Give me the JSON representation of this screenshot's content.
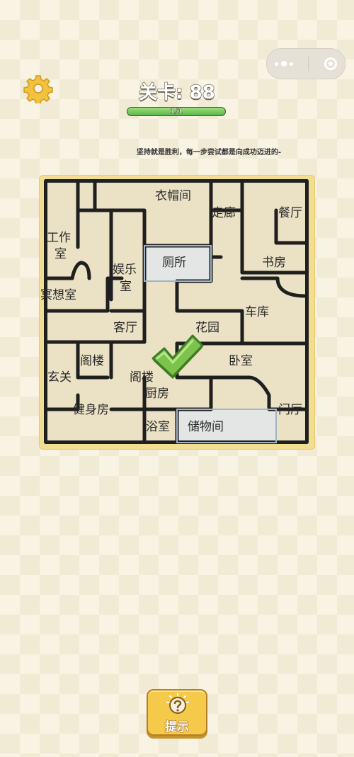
{
  "header": {
    "level_title": "关卡: 88",
    "progress_text": "1/1",
    "progress_fraction": 1.0,
    "tip": "坚持就是胜利，每一步尝试都是向成功迈进的-"
  },
  "capsule": {
    "more_icon": "more-dots-icon",
    "close_icon": "target-icon"
  },
  "settings_icon": "gear-icon",
  "rooms": {
    "cloakroom": "衣帽间",
    "corridor": "走廊",
    "dining": "餐厅",
    "study_work_1": "工作",
    "study_work_2": "室",
    "entertainment_1": "娱乐",
    "entertainment_2": "室",
    "toilet": "厕所",
    "study": "书房",
    "meditation": "冥想室",
    "garage": "车库",
    "living": "客厅",
    "garden": "花园",
    "attic_1": "阁楼",
    "bedroom": "卧室",
    "foyer": "玄关",
    "attic_2": "阁楼",
    "kitchen": "厨房",
    "gym": "健身房",
    "door_hall": "门厅",
    "bathroom": "浴室",
    "storage": "储物间"
  },
  "hint_button": {
    "label": "提示",
    "icon": "question-bulb-icon"
  },
  "colors": {
    "accent_green": "#5bb64a",
    "board_frame": "#f3dd91",
    "hint_yellow": "#f5c94a"
  }
}
